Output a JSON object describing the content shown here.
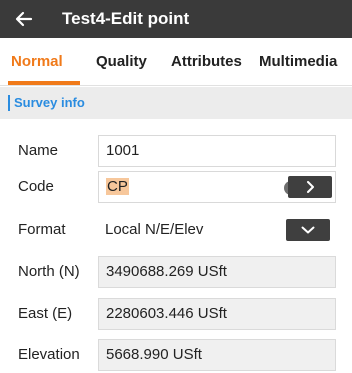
{
  "header": {
    "title": "Test4-Edit point"
  },
  "tabs": [
    "Normal",
    "Quality",
    "Attributes",
    "Multimedia"
  ],
  "active_tab": "Normal",
  "section": {
    "title": "Survey info"
  },
  "form": {
    "name": {
      "label": "Name",
      "value": "1001"
    },
    "code": {
      "label": "Code",
      "value": "CP"
    },
    "format": {
      "label": "Format",
      "value": "Local N/E/Elev"
    },
    "north": {
      "label": "North (N)",
      "value": "3490688.269 USft"
    },
    "east": {
      "label": "East (E)",
      "value": "2280603.446 USft"
    },
    "elevation": {
      "label": "Elevation",
      "value": "5668.990 USft"
    }
  },
  "colors": {
    "header_bg": "#3a3a3a",
    "accent": "#f07a1a",
    "section_text": "#2a8ce0",
    "highlight": "#f7c79b"
  },
  "icons": {
    "back": "arrow-left",
    "clear": "x-circle",
    "next": "chevron-right",
    "dropdown": "chevron-down"
  }
}
